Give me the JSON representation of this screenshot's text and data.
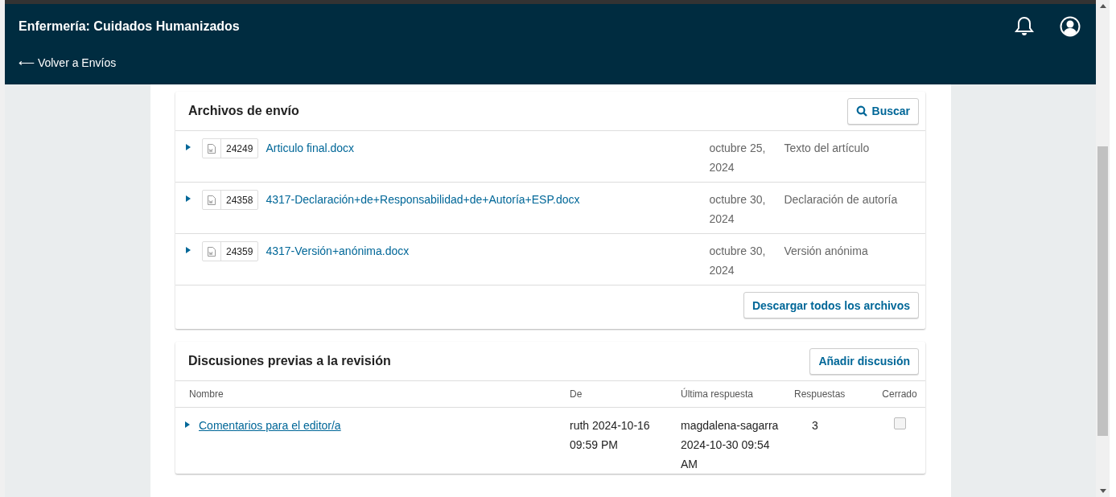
{
  "header": {
    "title": "Enfermería: Cuidados Humanizados",
    "back_link": "⟵ Volver a Envíos"
  },
  "files_panel": {
    "title": "Archivos de envío",
    "search_button": "Buscar",
    "files": [
      {
        "expanded": false,
        "id": "24249",
        "name": "Articulo final.docx",
        "date": "octubre 25, 2024",
        "type": "Texto del artículo"
      },
      {
        "expanded": false,
        "id": "24358",
        "name": "4317-Declaración+de+Responsabilidad+de+Autoría+ESP.docx",
        "date": "octubre 30, 2024",
        "type": "Declaración de autoría"
      },
      {
        "expanded": false,
        "id": "24359",
        "name": "4317-Versión+anónima.docx",
        "date": "octubre 30, 2024",
        "type": "Versión anónima"
      }
    ],
    "download_button": "Descargar todos los archivos"
  },
  "discussions_panel": {
    "title": "Discusiones previas a la revisión",
    "add_button": "Añadir discusión",
    "columns": [
      "Nombre",
      "De",
      "Última respuesta",
      "Respuestas",
      "Cerrado"
    ],
    "rows": [
      {
        "expanded": false,
        "name": "Comentarios para el editor/a",
        "from": "ruth 2024-10-16 09:59 PM",
        "last_reply": "magdalena-sagarra 2024-10-30 09:54 AM",
        "replies": "3",
        "closed": false
      }
    ]
  }
}
